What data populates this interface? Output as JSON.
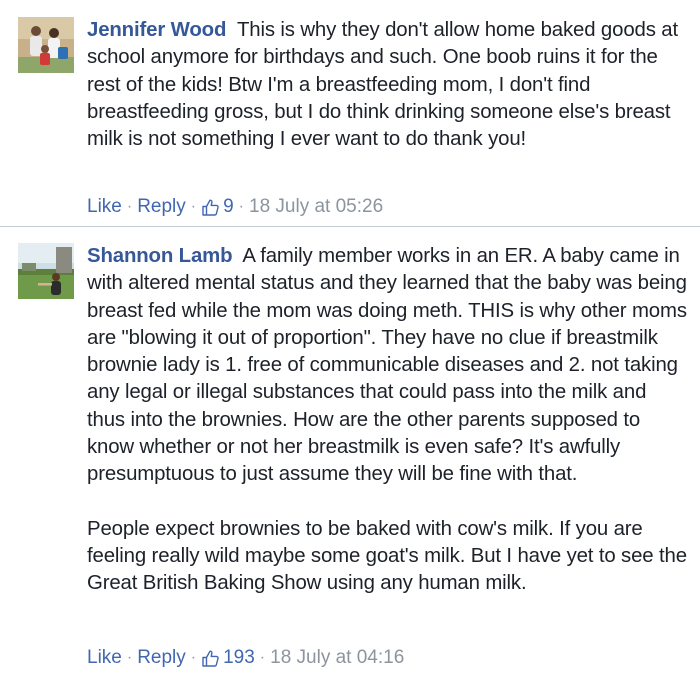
{
  "colors": {
    "link": "#4267b2",
    "author": "#365899",
    "meta": "#8d949e",
    "divider": "#c8ccd4"
  },
  "comments": [
    {
      "author": "Jennifer Wood",
      "text": "This is why they don't allow home baked goods at school anymore for birthdays and such. One boob ruins it for the rest of the kids! Btw I'm a breastfeeding mom, I don't find breastfeeding gross, but I do think drinking someone else's breast milk is not something I ever want to do thank you!",
      "like_label": "Like",
      "reply_label": "Reply",
      "like_icon": "thumbs-up-icon",
      "like_count": "9",
      "timestamp": "18 July at 05:26"
    },
    {
      "author": "Shannon Lamb",
      "text": "A family member works in an ER. A baby came in with altered mental status and they learned that the baby was being breast fed while the mom was doing meth. THIS is why other moms are \"blowing it out of proportion\". They have no clue if breastmilk brownie lady is 1. free of communicable diseases and 2. not taking any legal or illegal substances that could pass into the milk and thus into the brownies. How are the other parents supposed to know whether or not her breastmilk is even safe? It's awfully presumptuous to just assume they will be fine with that.",
      "text2": "People expect brownies to be baked with cow's milk. If you are feeling really wild maybe some goat's milk. But I have yet to see the Great British Baking Show using any human milk.",
      "like_label": "Like",
      "reply_label": "Reply",
      "like_icon": "thumbs-up-icon",
      "like_count": "193",
      "timestamp": "18 July at 04:16"
    }
  ]
}
